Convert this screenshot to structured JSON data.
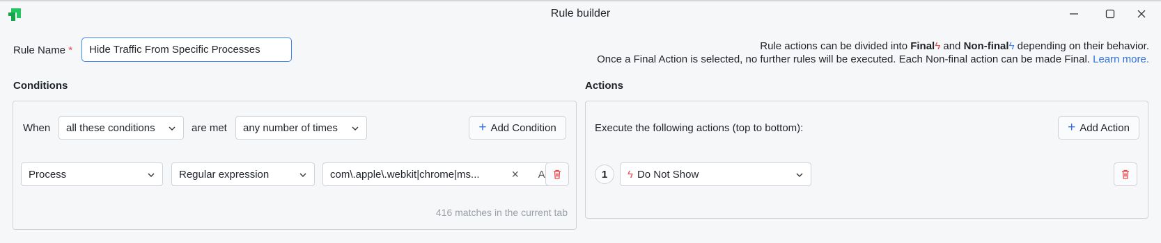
{
  "window": {
    "title": "Rule builder",
    "minimize_icon": "minimize-icon",
    "maximize_icon": "maximize-icon",
    "close_icon": "close-icon"
  },
  "rule_name": {
    "label": "Rule Name",
    "required_marker": "*",
    "value": "Hide Traffic From Specific Processes"
  },
  "info": {
    "line1_prefix": "Rule actions can be divided into ",
    "final_label": "Final",
    "and_text": " and ",
    "nonfinal_label": "Non-final",
    "line1_suffix": " depending on their behavior.",
    "line2": "Once a Final Action is selected, no further rules will be executed. Each Non-final action can be made Final. ",
    "learn_more": "Learn more."
  },
  "conditions": {
    "title": "Conditions",
    "when_label": "When",
    "match_mode": "all these conditions",
    "are_met_label": "are met",
    "frequency": "any number of times",
    "add_button": "Add Condition",
    "rows": [
      {
        "field": "Process",
        "operator": "Regular expression",
        "value": "com\\.apple\\.webkit|chrome|ms...",
        "case_toggle": "Aa"
      }
    ],
    "matches_text": "416 matches in the current tab"
  },
  "actions": {
    "title": "Actions",
    "description": "Execute the following actions (top to bottom):",
    "add_button": "Add Action",
    "items": [
      {
        "step": "1",
        "action": "Do Not Show"
      }
    ]
  },
  "colors": {
    "accent": "#2f6fdb",
    "final_bolt": "#e5484d",
    "nonfinal_bolt": "#3b82f6",
    "required": "#e5484d",
    "delete": "#e5484d",
    "logo": "#22c55e"
  }
}
